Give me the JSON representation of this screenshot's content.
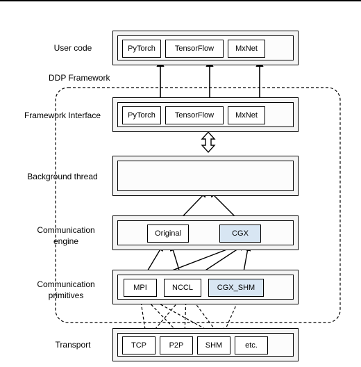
{
  "labels": {
    "user_code": "User code",
    "ddp_framework": "DDP Framework",
    "framework_interface": "Framework Interface",
    "background_thread": "Background thread",
    "communication_engine": "Communication\nengine",
    "communication_primitives": "Communication\nprimitives",
    "transport": "Transport"
  },
  "boxes": {
    "pytorch": "PyTorch",
    "tensorflow": "TensorFlow",
    "mxnet": "MxNet",
    "original": "Original",
    "cgx": "CGX",
    "mpi": "MPI",
    "nccl": "NCCL",
    "cgx_shm": "CGX_SHM",
    "tcp": "TCP",
    "p2p": "P2P",
    "shm": "SHM",
    "etc": "etc."
  }
}
